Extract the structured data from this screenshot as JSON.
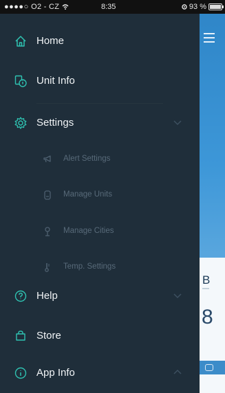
{
  "status_bar": {
    "signal_dots": "●●●●○",
    "carrier": "O2 - CZ",
    "time": "8:35",
    "battery_percent": "93 %"
  },
  "menu": {
    "home": "Home",
    "unit_info": "Unit Info",
    "settings": "Settings",
    "alert_settings": "Alert Settings",
    "manage_units": "Manage Units",
    "manage_cities": "Manage Cities",
    "temp_settings": "Temp. Settings",
    "help": "Help",
    "store": "Store",
    "app_info": "App Info"
  },
  "background_screen": {
    "card_letter": "B",
    "card_number": "8"
  },
  "colors": {
    "drawer_bg": "#1f2e3a",
    "accent": "#2fc3b2",
    "submenu_text": "#586a79",
    "content_blue": "#3d97d8"
  }
}
